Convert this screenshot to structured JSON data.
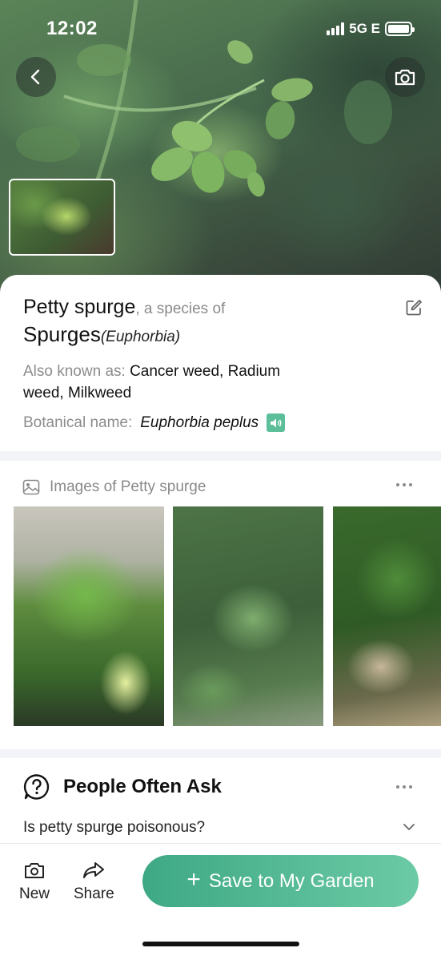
{
  "status_bar": {
    "time": "12:02",
    "network": "5G E"
  },
  "hero": {
    "back_icon": "chevron-left-icon",
    "camera_icon": "camera-icon"
  },
  "plant": {
    "common_name": "Petty spurge",
    "species_of_text": ", a species of",
    "genus": "Spurges",
    "genus_latin": "(Euphorbia)",
    "also_known_label": "Also known as:",
    "also_known_value": "Cancer weed, Radium weed, Milkweed",
    "botanical_label": "Botanical name:",
    "botanical_value": "Euphorbia peplus",
    "edit_icon": "edit-icon",
    "speaker_icon": "speaker-icon"
  },
  "images_section": {
    "title": "Images of Petty spurge",
    "icon": "image-icon"
  },
  "ask_section": {
    "title": "People Often Ask",
    "icon": "question-circle-icon",
    "questions": [
      "Is petty spurge poisonous?"
    ]
  },
  "bottom_bar": {
    "new_label": "New",
    "share_label": "Share",
    "save_label": "Save to My Garden"
  },
  "colors": {
    "accent": "#4fb68f",
    "accent_light": "#6ccaa6",
    "muted_text": "#8a8a8a"
  }
}
